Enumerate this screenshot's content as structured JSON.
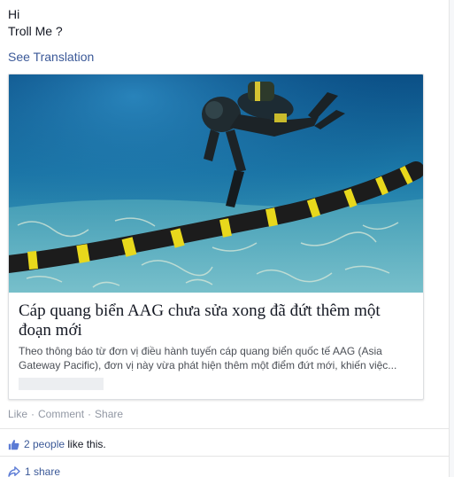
{
  "post": {
    "message_lines": [
      "Hi",
      "Troll Me ?"
    ],
    "see_translation": "See Translation"
  },
  "link_card": {
    "image_icon": "underwater-cable-diver-photo",
    "title": "Cáp quang biển AAG chưa sửa xong đã đứt thêm một đoạn mới",
    "description": "Theo thông báo từ đơn vị điều hành tuyến cáp quang biển quốc tế AAG (Asia Gateway Pacific), đơn vị này vừa phát hiện thêm một điểm đứt mới, khiến việc..."
  },
  "actions": {
    "like": "Like",
    "comment": "Comment",
    "share": "Share",
    "separator": "·"
  },
  "likes": {
    "icon": "thumbs-up-icon",
    "count_link": "2 people",
    "suffix": " like this."
  },
  "shares": {
    "icon": "share-arrow-icon",
    "count_link": "1 share"
  },
  "colors": {
    "link_blue": "#3b5998",
    "meta_gray": "#9197a3",
    "text": "#141823"
  }
}
